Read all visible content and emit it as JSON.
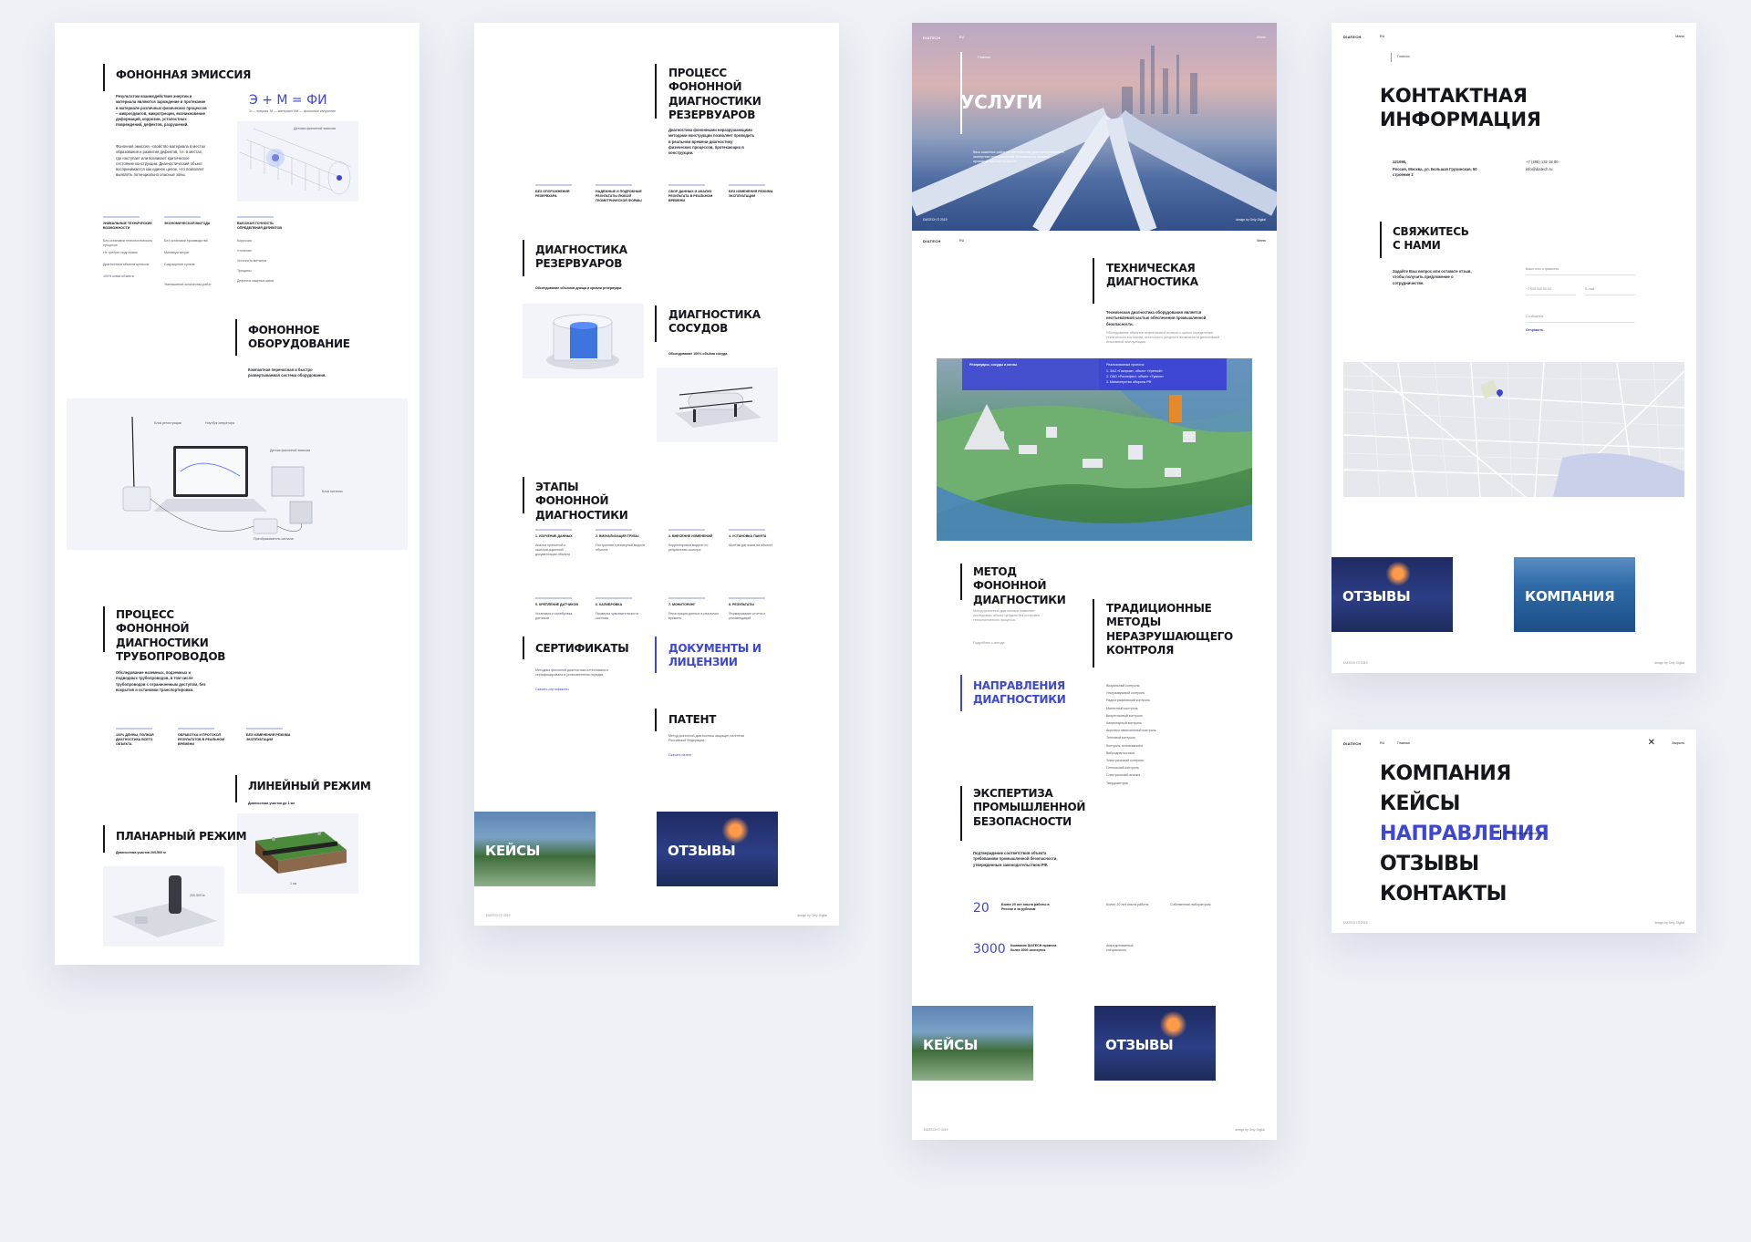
{
  "colors": {
    "accent": "#3d47d1",
    "bg": "#eef0f6",
    "text": "#15161c"
  },
  "common": {
    "logo": "DIATECH",
    "menu": "Меню",
    "lang": "RU",
    "copyright": "DIATECH © 2019",
    "credit": "design by Only Digital",
    "tile_cases": "Кейсы",
    "tile_reviews": "Отзывы",
    "tile_company": "Компания"
  },
  "p1": {
    "emission_title": "Фононная эмиссия",
    "emission_text": "Результатом взаимодействия энергии и материала являются зарождение и протекание в материале различных физических процессов – микросдвигов, микротрещин, возникновение деформаций, коррозии, усталостных повреждений, дефектов, разрушений.",
    "emission_text2": "Фононная эмиссия –свойство материала в местах образования и развития дефектов, т.е. в местах, где наступает или возникает критическое состояние конструкции. Диагностический объект воспринимается как единое целое, что позволяет выявлять потенциально опасные зоны.",
    "formula": "Э + М = ФИ",
    "formula_legend": [
      "Э — энергия",
      "М — материал",
      "ФИ — фононное излучение"
    ],
    "pipe_caption": "Датчики фононной эмиссии",
    "col1": {
      "h": "Уникальные технические возможности",
      "items": [
        "Без остановки технологического процесса",
        "Не требует подготовки",
        "Диагностика объекта целиком",
        "100% охват объекта"
      ]
    },
    "col2": {
      "h": "Экономическая выгода",
      "items": [
        "Без остановки производства",
        "Минимум затрат",
        "Сокращение сроков",
        "Уменьшение количества работ"
      ]
    },
    "col3": {
      "h": "Высокая точность определения дефектов",
      "items": [
        "Коррозия",
        "Утонение",
        "Усталость металла",
        "Трещины",
        "Дефекты сварных швов"
      ]
    },
    "equip_title": "Фононное оборудование",
    "equip_text": "Компактная переносная и быстро развертываемая система оборудования.",
    "equip_labels": [
      "Блок регистрации",
      "Ноутбук оператора",
      "Датчик фононной эмиссии",
      "Блок питания",
      "Преобразователь сигнала"
    ],
    "pipeline_title": "Процесс фононной диагностики трубопроводов",
    "pipeline_text": "Обследование наземных, подземных и подводных трубопроводов, в том числе трубопроводов с ограниченным доступом, без вскрытия и остановки транспортировки.",
    "pipe_feats": [
      "100% длины, полная диагностика всего объекта",
      "Обработка и протокол результатов в реальном времени",
      "Без изменения режима эксплуатации"
    ],
    "linear_title": "Линейный режим",
    "linear_text": "Диагностика участка до 1 км",
    "planar_title": "Планарный режим",
    "planar_text": "Диагностика участка 200-500 м",
    "dim1": "1 км",
    "dim2": "200-500 м"
  },
  "p2": {
    "tank_process_title": "Процесс фононной диагностики резервуаров",
    "tank_process_text": "Диагностика фононными неразрушающими методами конструкции позволяет проводить в реальном времени диагностику физических процессов, протекающих в конструкции.",
    "tank_feats": [
      "Без опорожнения резервуара",
      "Надежные и подробные результаты любой геометрической формы",
      "Сбор данных и анализ результата в реальном времени",
      "Без изменения режима эксплуатации"
    ],
    "tank_title": "Диагностика резервуаров",
    "tank_text": "Обследование объёмов днища и кровли резервуара",
    "vessel_title": "Диагностика сосудов",
    "vessel_text": "Обследование 100% объёма сосуда",
    "stages_title": "Этапы фононной диагностики",
    "stages": [
      {
        "h": "1. Изучение данных",
        "t": "Анализ проектной и эксплуатационной документации объекта"
      },
      {
        "h": "2. Визуализация трубы",
        "t": "Построение трехмерной модели объекта"
      },
      {
        "h": "3. Внесение изменений",
        "t": "Корректировка модели по результатам осмотра"
      },
      {
        "h": "4. Установка пакета",
        "t": "Монтаж датчиков на объекте"
      },
      {
        "h": "5. Крепление датчиков",
        "t": "Установка и калибровка датчиков"
      },
      {
        "h": "6. Калибровка",
        "t": "Проверка чувствительности системы"
      },
      {
        "h": "7. Мониторинг",
        "t": "Регистрация данных в реальном времени"
      },
      {
        "h": "8. Результаты",
        "t": "Формирование отчета и рекомендаций"
      }
    ],
    "certs_title": "Сертификаты",
    "certs_text": "Методика фононной диагностики аттестована и сертифицирована в установленном порядке.",
    "certs_link": "Скачать сертификаты",
    "docs_title": "Документы и лицензии",
    "patent_title": "Патент",
    "patent_text": "Метод фононной диагностики защищен патентом Российской Федерации.",
    "patent_link": "Скачать патент"
  },
  "p3": {
    "breadcrumb": "Главная",
    "hero_title": "Услуги",
    "hero_text": "Весь комплекс работ по техническому диагностированию и экспертизе промышленной безопасности опасных производственных объектов",
    "tech_title": "Техническая диагностика",
    "tech_text": "Техническая диагностика оборудования является неотъемлемой частью обеспечения промышленной безопасности.",
    "tech_text2": "Обследование объектов нефтегазовой отрасли с целью определения технического состояния, остаточного ресурса и возможности дальнейшей безопасной эксплуатации.",
    "map_head": "Резервуары, сосуды и котлы",
    "map_head2": "Реализованные проекты:",
    "map_items": [
      "1. ЗАО «Газпром», объект «Уренгой»",
      "2. ОАО «Роснефть», объект «Туапсе»",
      "3. Министерство обороны РФ"
    ],
    "method_title": "Метод фононной диагностики",
    "method_text": "Метод фононной диагностики позволяет исследовать объект целиком без остановки технологического процесса.",
    "method_link": "Подробнее о методе",
    "trad_title": "Традиционные методы неразрушающего контроля",
    "trad_items": [
      "Визуальный контроль",
      "Ультразвуковой контроль",
      "Радиографический контроль",
      "Магнитный контроль",
      "Вихретоковый контроль",
      "Капиллярный контроль",
      "Акустико-эмиссионный контроль",
      "Тепловой контроль",
      "Контроль течеисканием",
      "Вибродиагностика",
      "Электрический контроль",
      "Оптический контроль",
      "Спектральный анализ",
      "Твердометрия"
    ],
    "directions_title": "Направления диагностики",
    "expert_title": "Экспертиза промышленной безопасности",
    "expert_text": "Подтверждение соответствия объекта требованиям промышленной безопасности, утвержденным законодательством РФ.",
    "stat1_num": "20",
    "stat1_text": "Более 20 лет опыта работы в России и за рубежом",
    "stat2_num": "3000",
    "stat2_text": "Компания DIATECH провела более 3000 экспертиз",
    "expert_notes": [
      "Более 20 лет опыта работы",
      "Собственная лаборатория",
      "Аккредитованные специалисты"
    ]
  },
  "p4": {
    "breadcrumb": "Главная",
    "contact_title": "Контактная информация",
    "address_label": "121096,",
    "address": "Россия, Москва, ул. Большая Грузинская, 50 строение 2",
    "phone": "+7 (495) 132 18 00",
    "email": "info@diatech.ru",
    "form_title": "Свяжитесь с нами",
    "form_text": "Задайте Ваш вопрос или оставьте отзыв, чтобы получить предложение о сотрудничестве.",
    "field_name": "Ваше имя и фамилия",
    "field_phone": "+7 000 000 00 00",
    "field_email": "E-mail",
    "field_msg": "Сообщение",
    "send": "Отправить"
  },
  "p5": {
    "breadcrumb": "Главная",
    "close": "Закрыть",
    "nav": [
      "Компания",
      "Кейсы",
      "Направления",
      "Отзывы",
      "Контакты"
    ],
    "active_index": 2,
    "sub": "Фононная диагностика"
  }
}
